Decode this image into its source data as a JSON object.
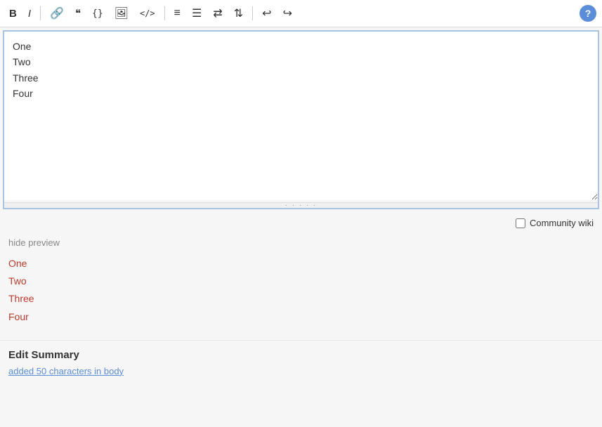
{
  "toolbar": {
    "buttons": [
      {
        "name": "bold",
        "label": "B",
        "class": "icon-bold",
        "title": "Bold"
      },
      {
        "name": "italic",
        "label": "I",
        "class": "icon-italic",
        "title": "Italic"
      },
      {
        "name": "link",
        "label": "🔗",
        "class": "icon-link",
        "title": "Link"
      },
      {
        "name": "quote",
        "label": "❝",
        "class": "icon-quote",
        "title": "Blockquote"
      },
      {
        "name": "code-inline",
        "label": "{}",
        "class": "icon-code",
        "title": "Code"
      },
      {
        "name": "image",
        "label": "🖼",
        "class": "icon-image",
        "title": "Image"
      },
      {
        "name": "html",
        "label": "</>",
        "class": "icon-html",
        "title": "HTML"
      },
      {
        "name": "ol",
        "label": "≡",
        "class": "icon-ol",
        "title": "Ordered List"
      },
      {
        "name": "ul",
        "label": "☰",
        "class": "icon-ul",
        "title": "Unordered List"
      },
      {
        "name": "indent",
        "label": "≡",
        "class": "icon-indent",
        "title": "Indent"
      },
      {
        "name": "outdent",
        "label": "≡",
        "class": "icon-outdent",
        "title": "Outdent"
      },
      {
        "name": "undo",
        "label": "↩",
        "class": "icon-undo",
        "title": "Undo"
      },
      {
        "name": "redo",
        "label": "↪",
        "class": "icon-redo",
        "title": "Redo"
      }
    ],
    "help_label": "?"
  },
  "editor": {
    "content": "One\nTwo\nThree\nFour",
    "lines": [
      "One",
      "Two",
      "Three",
      "Four"
    ]
  },
  "community_wiki": {
    "label": "Community wiki",
    "checked": false
  },
  "preview": {
    "hide_link": "hide preview",
    "lines": [
      "One",
      "Two",
      "Three",
      "Four"
    ]
  },
  "edit_summary": {
    "title": "Edit Summary",
    "hint": "added 50 characters in body"
  }
}
